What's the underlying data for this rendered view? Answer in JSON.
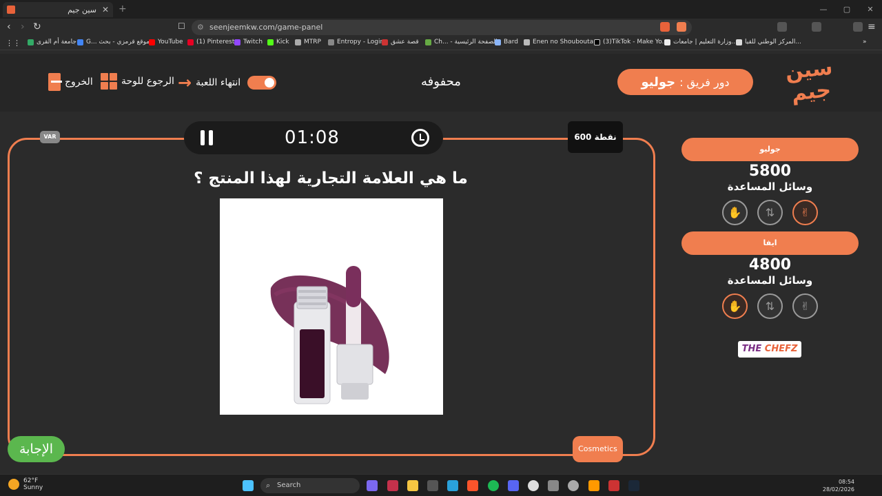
{
  "browser": {
    "tab_title": "سين جيم",
    "tab_close": "✕",
    "new_tab": "+",
    "url": "seenjeemkw.com/game-panel",
    "bookmarks": [
      "جامعة أم القرى",
      "G... موقع قرمزي - بحث",
      "YouTube",
      "(1) Pinterest",
      "Twitch",
      "Kick",
      "MTRP",
      "Entropy - Login",
      "قصة عشق",
      "Ch... - الصفحة الرئيسية",
      "Bard",
      "Enen no Shoubouta...",
      "(3)TikTok - Make Yo...",
      "وزارة التعليم | جامعات...",
      "المركز الوطني للقيا..."
    ]
  },
  "header": {
    "exit_label": "الخروج",
    "board_label": "الرجوع للوحة",
    "end_game_label": "انتهاء اللعبة",
    "game_title": "محفوفه",
    "turn_prefix": "دور فريق :",
    "turn_team": "جوليو",
    "logo_text": "سين جيم"
  },
  "question_panel": {
    "var_label": "VAR",
    "timer": "01:08",
    "points": "600 نقطة",
    "question": "ما هي العلامة التجارية لهذا المنتج ؟",
    "answer_button": "الإجابة",
    "category": "Cosmetics"
  },
  "teams": [
    {
      "name": "جوليو",
      "score": "5800",
      "aids_label": "وسائل المساعدة",
      "active_aid": "two-answers"
    },
    {
      "name": "ايفا",
      "score": "4800",
      "aids_label": "وسائل المساعدة",
      "active_aid": "hand"
    }
  ],
  "sponsor": {
    "part1": "THE",
    "part2": "CHEFZ"
  },
  "taskbar": {
    "temp": "62°F",
    "condition": "Sunny",
    "search_placeholder": "Search",
    "time": "08:54",
    "date": "28/02/2026"
  },
  "colors": {
    "accent": "#f07e4f",
    "answer": "#5bb74e",
    "background": "#2b2b2b"
  }
}
